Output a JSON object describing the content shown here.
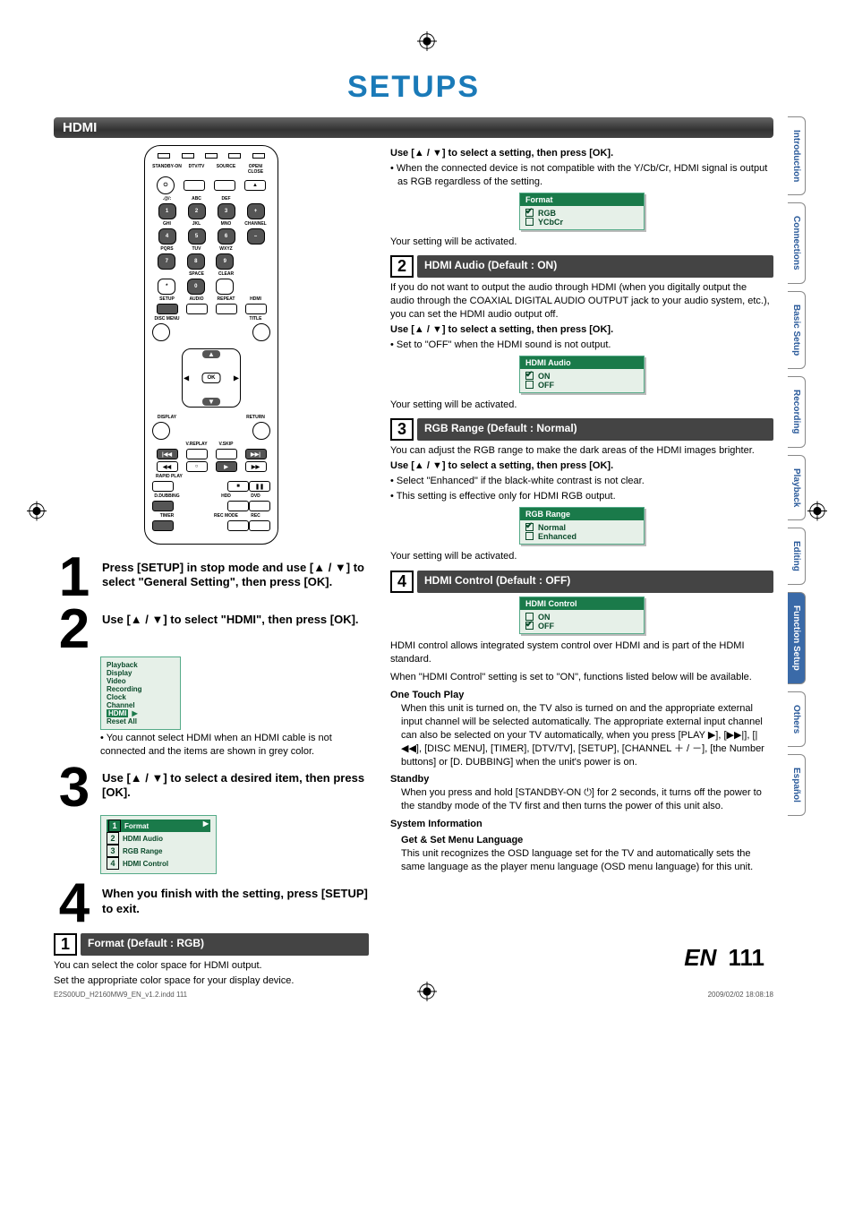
{
  "title": "SETUPS",
  "section": "HDMI",
  "tabs": [
    "Introduction",
    "Connections",
    "Basic Setup",
    "Recording",
    "Playback",
    "Editing",
    "Function Setup",
    "Others",
    "Español"
  ],
  "active_tab": "Function Setup",
  "remote": {
    "row1": [
      "STANDBY-ON",
      "DTV/TV",
      "SOURCE",
      "OPEN/\nCLOSE"
    ],
    "abc": [
      ".@/:",
      "ABC",
      "DEF",
      ""
    ],
    "nums1": [
      "1",
      "2",
      "3",
      "+"
    ],
    "ghi": [
      "GHI",
      "JKL",
      "MNO",
      "CHANNEL"
    ],
    "nums2": [
      "4",
      "5",
      "6",
      "–"
    ],
    "pqr": [
      "PQRS",
      "TUV",
      "WXYZ",
      ""
    ],
    "nums3": [
      "7",
      "8",
      "9",
      ""
    ],
    "space": [
      "",
      "SPACE",
      "CLEAR",
      ""
    ],
    "zero": [
      "*",
      "0",
      "",
      ""
    ],
    "setup": [
      "SETUP",
      "AUDIO",
      "REPEAT",
      "HDMI"
    ],
    "disc": [
      "DISC MENU",
      "",
      "",
      "TITLE"
    ],
    "display": [
      "DISPLAY",
      "",
      "",
      "RETURN"
    ],
    "vr": [
      "",
      "V.REPLAY",
      "V.SKIP",
      ""
    ],
    "rapid": "RAPID PLAY",
    "dd": [
      "D.DUBBING",
      "",
      "HDD",
      "DVD"
    ],
    "timer": [
      "TIMER",
      "",
      "REC MODE",
      "REC"
    ]
  },
  "steps": {
    "s1": {
      "n": "1",
      "txt": "Press [SETUP] in stop mode and use [▲ / ▼] to select \"General Setting\", then press [OK]."
    },
    "s2": {
      "n": "2",
      "txt": "Use [▲ / ▼] to select \"HDMI\", then press [OK].",
      "menu": [
        "Playback",
        "Display",
        "Video",
        "Recording",
        "Clock",
        "Channel",
        "HDMI",
        "Reset All"
      ],
      "hl": "HDMI",
      "note": "• You cannot select HDMI when an HDMI cable is not connected and the items are shown in grey color."
    },
    "s3": {
      "n": "3",
      "txt": "Use [▲ / ▼] to select a desired item, then press [OK].",
      "menu": [
        "Format",
        "HDMI Audio",
        "RGB Range",
        "HDMI Control"
      ],
      "hl": "Format"
    },
    "s4": {
      "n": "4",
      "txt": "When you finish with the setting, press [SETUP] to exit."
    }
  },
  "subL": {
    "n": "1",
    "t": "Format (Default : RGB)",
    "l1": "You can select the color space for HDMI output.",
    "l2": "Set the appropriate color space for your display device."
  },
  "right": {
    "intro1": "Use [▲ / ▼] to select a setting, then press [OK].",
    "intro2": "• When the connected device is not compatible with the Y/Cb/Cr, HDMI signal is output as RGB regardless of the setting.",
    "box1": {
      "hd": "Format",
      "opts": [
        {
          "l": "RGB",
          "on": true
        },
        {
          "l": "YCbCr",
          "on": false
        }
      ]
    },
    "act": "Your setting will be activated.",
    "s2": {
      "n": "2",
      "t": "HDMI Audio (Default : ON)",
      "p": "If you do not want to output the audio through HDMI (when you digitally output the audio through the COAXIAL DIGITAL AUDIO OUTPUT jack to your audio system, etc.), you can set the HDMI audio output off.",
      "use": "Use [▲ / ▼] to select a setting, then press [OK].",
      "b": "• Set to \"OFF\" when the HDMI sound is not output.",
      "box": {
        "hd": "HDMI Audio",
        "opts": [
          {
            "l": "ON",
            "on": true
          },
          {
            "l": "OFF",
            "on": false
          }
        ]
      }
    },
    "s3": {
      "n": "3",
      "t": "RGB Range (Default : Normal)",
      "p": "You can adjust the RGB range to make the dark areas of the HDMI images brighter.",
      "use": "Use [▲ / ▼] to select a setting, then press [OK].",
      "b1": "• Select \"Enhanced\" if the black-white contrast is not clear.",
      "b2": "• This setting is effective only for HDMI RGB output.",
      "box": {
        "hd": "RGB Range",
        "opts": [
          {
            "l": "Normal",
            "on": true
          },
          {
            "l": "Enhanced",
            "on": false
          }
        ]
      }
    },
    "s4": {
      "n": "4",
      "t": "HDMI Control (Default : OFF)",
      "box": {
        "hd": "HDMI Control",
        "opts": [
          {
            "l": "ON",
            "on": false
          },
          {
            "l": "OFF",
            "on": true
          }
        ]
      },
      "p1": "HDMI control allows integrated system control over HDMI and is part of the HDMI standard.",
      "p2": "When \"HDMI Control\" setting is set to \"ON\", functions listed below will be available.",
      "otp_h": "One Touch Play",
      "otp": "When this unit is turned on, the TV also is turned on and the appropriate external input channel will be selected automatically. The appropriate external input channel can also be selected on your TV automatically, when you press [PLAY ▶], [▶▶|], [|◀◀], [DISC MENU], [TIMER], [DTV/TV], [SETUP], [CHANNEL ＋ / －], [the Number buttons] or [D. DUBBING] when the unit's power is on.",
      "stb_h": "Standby",
      "stb": "When you press and hold [STANDBY-ON ⏻] for 2 seconds, it turns off the power to the standby mode of the TV first and then turns the power of this unit also.",
      "si_h": "System Information",
      "gs_h": "Get & Set Menu Language",
      "gs": "This unit recognizes the OSD language set for the TV and automatically sets the same language as the player menu language (OSD menu language) for this unit."
    }
  },
  "page": {
    "en": "EN",
    "num": "111"
  },
  "footer": {
    "file": "E2S00UD_H2160MW9_EN_v1.2.indd   111",
    "date": "2009/02/02   18:08:18"
  }
}
